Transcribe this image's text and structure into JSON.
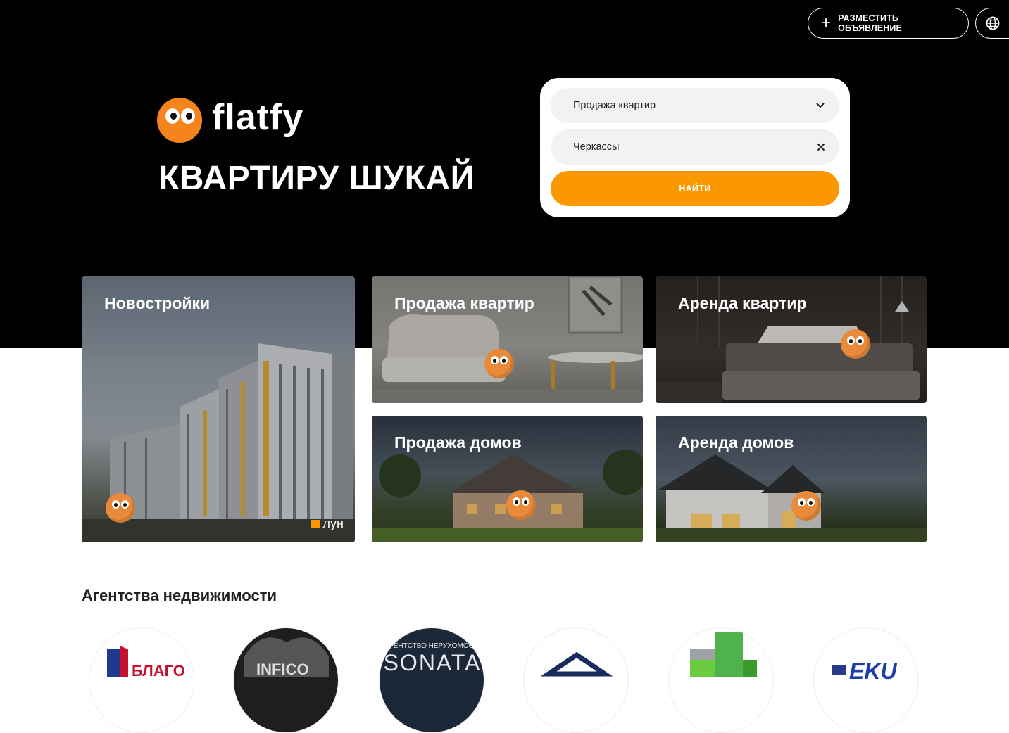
{
  "header": {
    "post_ad_label": "РАЗМЕСТИТЬ ОБЪЯВЛЕНИЕ",
    "language_icon": "globe-icon"
  },
  "brand": {
    "logo_text": "flatfy",
    "slogan": "КВАРТИРУ ШУКАЙ",
    "accent": "#fb9800"
  },
  "search": {
    "deal_type_value": "Продажа квартир",
    "city_value": "Черкассы",
    "find_label": "НАЙТИ"
  },
  "categories": [
    {
      "title": "Новостройки",
      "badge": "лун"
    },
    {
      "title": "Продажа квартир"
    },
    {
      "title": "Аренда квартир"
    },
    {
      "title": "Продажа домов"
    },
    {
      "title": "Аренда домов"
    }
  ],
  "agencies": {
    "title": "Агентства недвижимости",
    "logos": [
      "БЛАГО",
      "INFICO",
      "SONATA",
      "",
      "",
      "EKU"
    ],
    "sonata_tagline": "АГЕНТСТВО НЕРУХОМОСТІ"
  }
}
